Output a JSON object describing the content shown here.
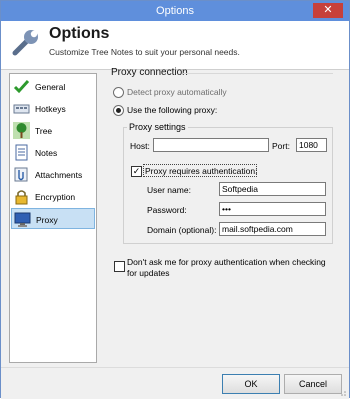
{
  "window": {
    "title": "Options",
    "close_glyph": "✕"
  },
  "header": {
    "title": "Options",
    "subtitle": "Customize Tree Notes to suit your personal needs.",
    "icon": "wrench-icon"
  },
  "sidebar": {
    "items": [
      {
        "label": "General",
        "icon": "checkmark-icon",
        "active": false
      },
      {
        "label": "Hotkeys",
        "icon": "keyboard-icon",
        "active": false
      },
      {
        "label": "Tree",
        "icon": "tree-icon",
        "active": false
      },
      {
        "label": "Notes",
        "icon": "notes-icon",
        "active": false
      },
      {
        "label": "Attachments",
        "icon": "paperclip-icon",
        "active": false
      },
      {
        "label": "Encryption",
        "icon": "padlock-icon",
        "active": false
      },
      {
        "label": "Proxy",
        "icon": "monitor-icon",
        "active": true
      }
    ]
  },
  "proxy": {
    "section_title": "Proxy connection",
    "detect_label": "Detect proxy automatically",
    "use_label": "Use the following proxy:",
    "selected": "use",
    "settings_label": "Proxy settings",
    "host_label": "Host:",
    "host_value": "",
    "port_label": "Port:",
    "port_value": "1080",
    "auth_label": "Proxy requires authentication:",
    "auth_checked": true,
    "username_label": "User name:",
    "username_value": "Softpedia",
    "password_label": "Password:",
    "password_value": "•••",
    "domain_label": "Domain (optional):",
    "domain_value": "mail.softpedia.com",
    "dont_ask_label_line1": "Don't ask me for proxy authentication when checking",
    "dont_ask_label_line2": "for updates",
    "dont_ask_checked": false
  },
  "footer": {
    "ok_label": "OK",
    "cancel_label": "Cancel"
  },
  "colors": {
    "titlebar": "#5f8fdc",
    "close": "#c7403a",
    "selection": "#c8e0f4"
  }
}
